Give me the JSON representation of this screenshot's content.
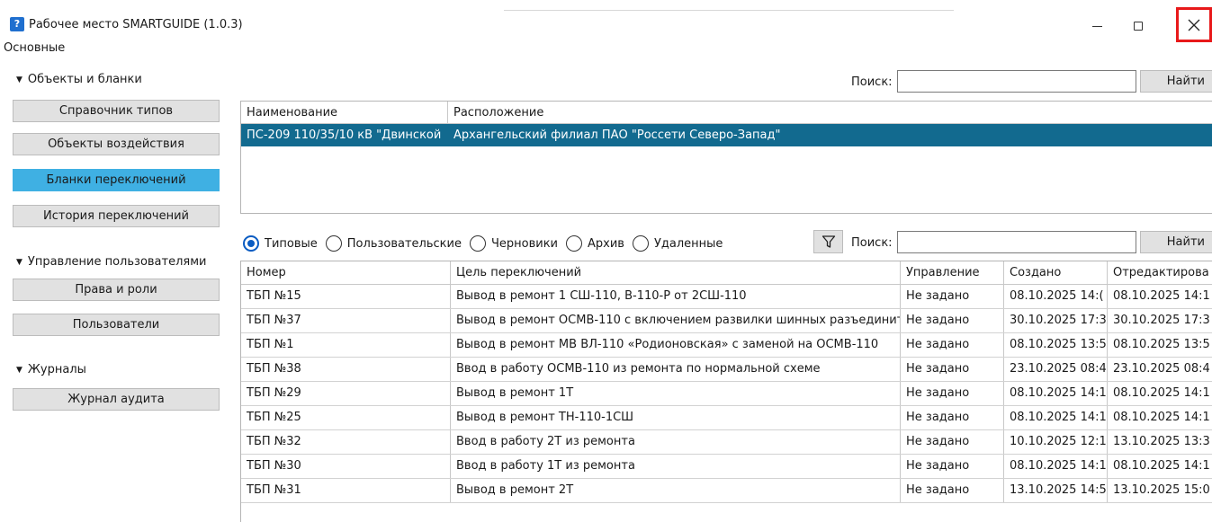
{
  "window": {
    "title": "Рабочее место SMARTGUIDE (1.0.3)",
    "icon": "app-key-icon",
    "controls": [
      "minimize-icon",
      "maximize-icon",
      "close-icon"
    ],
    "close_highlight_color": "#e8191a"
  },
  "menu": {
    "label": "Основные"
  },
  "sidebar": {
    "sections": [
      {
        "title": "Объекты и бланки",
        "buttons": [
          {
            "label": "Справочник типов",
            "active": false
          },
          {
            "label": "Объекты воздействия",
            "active": false
          },
          {
            "label": "Бланки переключений",
            "active": true
          },
          {
            "label": "История переключений",
            "active": false
          }
        ]
      },
      {
        "title": "Управление пользователями",
        "buttons": [
          {
            "label": "Права и роли",
            "active": false
          },
          {
            "label": "Пользователи",
            "active": false
          }
        ]
      },
      {
        "title": "Журналы",
        "buttons": [
          {
            "label": "Журнал аудита",
            "active": false
          }
        ]
      }
    ],
    "active_color": "#3fb0e3"
  },
  "objects": {
    "search_label": "Поиск:",
    "search_value": "",
    "find_label": "Найти",
    "columns": [
      "Наименование",
      "Расположение"
    ],
    "rows": [
      {
        "name": "ПС-209 110/35/10 кВ \"Двинской",
        "location": "Архангельский филиал ПАО \"Россети Северо-Запад\"",
        "selected": true
      }
    ],
    "selected_color": "#126a8f"
  },
  "blanks": {
    "radios": [
      {
        "label": "Типовые",
        "selected": true
      },
      {
        "label": "Пользовательские",
        "selected": false
      },
      {
        "label": "Черновики",
        "selected": false
      },
      {
        "label": "Архив",
        "selected": false
      },
      {
        "label": "Удаленные",
        "selected": false
      }
    ],
    "filter_icon": "filter-icon",
    "search_label": "Поиск:",
    "search_value": "",
    "find_label": "Найти",
    "columns": [
      "Номер",
      "Цель переключений",
      "Управление",
      "Создано",
      "Отредактирова"
    ],
    "rows": [
      [
        "ТБП №15",
        "Вывод в ремонт 1 СШ-110, В-110-Р от 2СШ-110",
        "Не задано",
        "08.10.2025 14:(",
        "08.10.2025 14:1"
      ],
      [
        "ТБП №37",
        "Вывод в ремонт ОСМВ-110 с включением развилки шинных разъединит",
        "Не задано",
        "30.10.2025 17:3",
        "30.10.2025 17:3"
      ],
      [
        "ТБП №1",
        "Вывод в ремонт МВ ВЛ-110 «Родионовская» с заменой на ОСМВ-110",
        "Не задано",
        "08.10.2025 13:5",
        "08.10.2025 13:5"
      ],
      [
        "ТБП №38",
        "Ввод в работу ОСМВ-110 из ремонта по нормальной схеме",
        "Не задано",
        "23.10.2025 08:4",
        "23.10.2025 08:4"
      ],
      [
        "ТБП №29",
        "Вывод в ремонт 1Т",
        "Не задано",
        "08.10.2025 14:1",
        "08.10.2025 14:1"
      ],
      [
        "ТБП №25",
        "Вывод в ремонт ТН-110-1СШ",
        "Не задано",
        "08.10.2025 14:1",
        "08.10.2025 14:1"
      ],
      [
        "ТБП №32",
        "Ввод в работу 2Т из ремонта",
        "Не задано",
        "10.10.2025 12:1",
        "13.10.2025 13:3"
      ],
      [
        "ТБП №30",
        "Ввод  в  работу  1Т из ремонта",
        "Не задано",
        "08.10.2025 14:1",
        "08.10.2025 14:1"
      ],
      [
        "ТБП №31",
        "Вывод в ремонт 2Т",
        "Не задано",
        "13.10.2025 14:5",
        "13.10.2025 15:0"
      ]
    ]
  }
}
